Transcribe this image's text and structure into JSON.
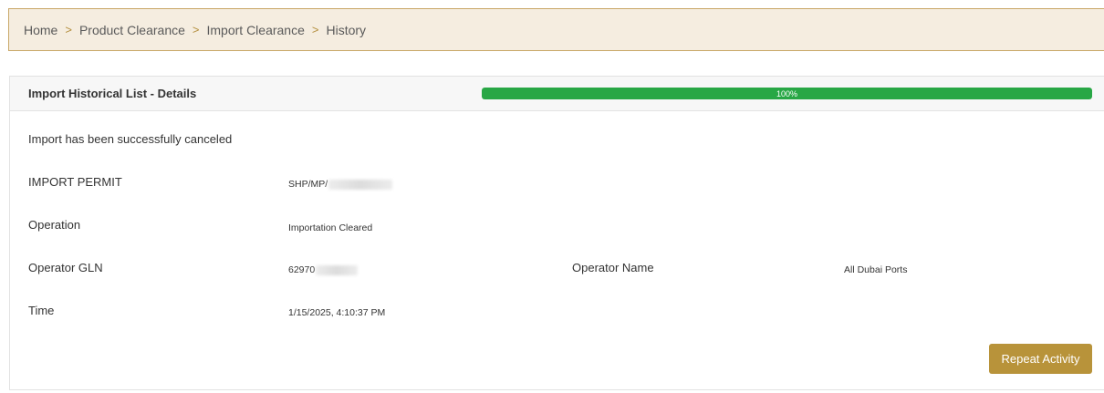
{
  "breadcrumb": {
    "items": [
      "Home",
      "Product Clearance",
      "Import Clearance"
    ],
    "current": "History",
    "separator": ">"
  },
  "panel": {
    "title": "Import Historical List - Details",
    "progress": {
      "percent": 100,
      "label": "100%",
      "color": "#28a745"
    }
  },
  "details": {
    "status_message": "Import has been successfully canceled",
    "import_permit": {
      "label": "IMPORT PERMIT",
      "value": "SHP/MP/"
    },
    "operation": {
      "label": "Operation",
      "value": "Importation Cleared"
    },
    "operator_gln": {
      "label": "Operator GLN",
      "value": "62970"
    },
    "operator_name": {
      "label": "Operator Name",
      "value": "All Dubai Ports"
    },
    "time": {
      "label": "Time",
      "value": "1/15/2025, 4:10:37 PM"
    }
  },
  "actions": {
    "repeat_label": "Repeat Activity"
  },
  "colors": {
    "accent": "#b8933a",
    "breadcrumb_bg": "#f5ede0",
    "success": "#28a745"
  }
}
